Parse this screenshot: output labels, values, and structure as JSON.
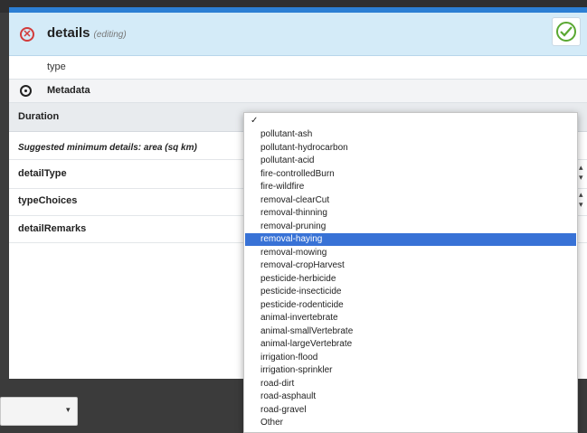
{
  "header": {
    "title": "details",
    "status": "(editing)"
  },
  "type_row": {
    "label": "type"
  },
  "metadata_row": {
    "label": "Metadata"
  },
  "duration_row": {
    "label": "Duration"
  },
  "suggestion": "Suggested minimum details: area (sq km)",
  "fields": [
    {
      "label": "detailType"
    },
    {
      "label": "typeChoices"
    },
    {
      "label": "detailRemarks"
    }
  ],
  "dropdown": {
    "checkmark": "✓",
    "selected": "removal-haying",
    "options": [
      "pollutant-ash",
      "pollutant-hydrocarbon",
      "pollutant-acid",
      "fire-controlledBurn",
      "fire-wildfire",
      "removal-clearCut",
      "removal-thinning",
      "removal-pruning",
      "removal-haying",
      "removal-mowing",
      "removal-cropHarvest",
      "pesticide-herbicide",
      "pesticide-insecticide",
      "pesticide-rodenticide",
      "animal-invertebrate",
      "animal-smallVertebrate",
      "animal-largeVertebrate",
      "irrigation-flood",
      "irrigation-sprinkler",
      "road-dirt",
      "road-asphault",
      "road-gravel",
      "Other"
    ]
  },
  "icons": {
    "close": "close-circle-icon",
    "confirm": "check-circle-icon",
    "metadata": "eye-icon"
  },
  "colors": {
    "header_bg": "#d4ebf8",
    "close": "#d23b3b",
    "confirm": "#5aa832",
    "selection": "#3872d6"
  }
}
